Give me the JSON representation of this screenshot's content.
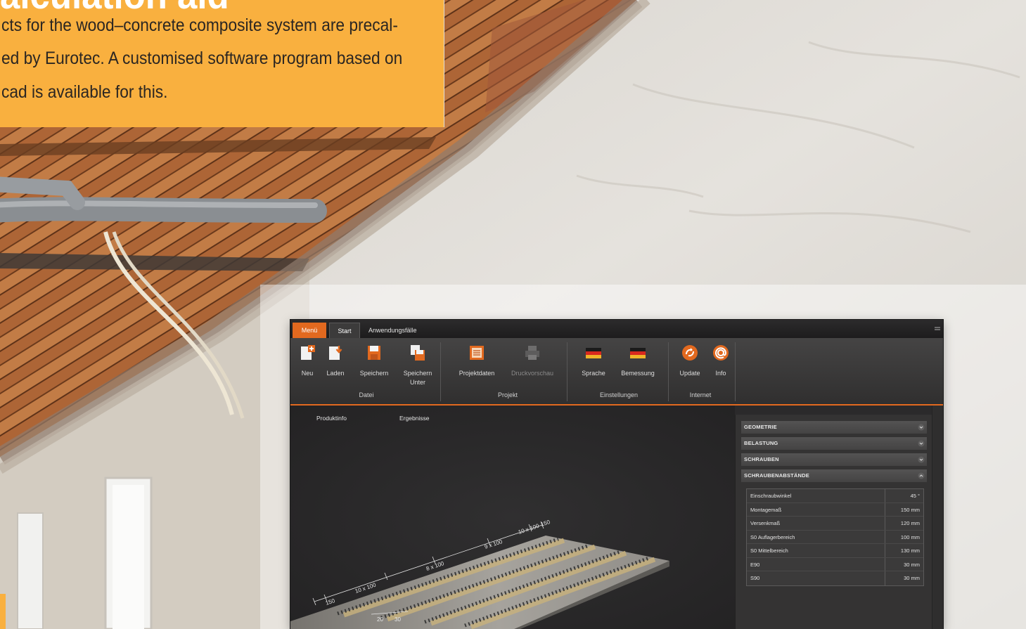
{
  "brochure": {
    "heading": "alculation aid",
    "text_lines": [
      "cts for the wood–concrete composite system are precal-",
      "ed by Eurotec. A customised software program based on",
      "cad is available for this."
    ]
  },
  "app": {
    "tabs": [
      "Menü",
      "Start",
      "Anwendungsfälle"
    ],
    "active_tab": "Start",
    "ribbon": {
      "groups": [
        {
          "label": "Datei",
          "buttons": [
            {
              "label": "Neu",
              "icon": "new-file-icon",
              "enabled": true
            },
            {
              "label": "Laden",
              "icon": "open-file-icon",
              "enabled": true
            },
            {
              "label": "Speichern",
              "icon": "save-icon",
              "enabled": true
            },
            {
              "label": "Speichern Unter",
              "icon": "save-as-icon",
              "enabled": true
            }
          ]
        },
        {
          "label": "Projekt",
          "buttons": [
            {
              "label": "Projektdaten",
              "icon": "project-data-icon",
              "enabled": true
            },
            {
              "label": "Druckvorschau",
              "icon": "print-preview-icon",
              "enabled": false
            }
          ]
        },
        {
          "label": "Einstellungen",
          "buttons": [
            {
              "label": "Sprache",
              "icon": "language-flag-icon",
              "enabled": true
            },
            {
              "label": "Bemessung",
              "icon": "design-standard-flag-icon",
              "enabled": true
            }
          ]
        },
        {
          "label": "Internet",
          "buttons": [
            {
              "label": "Update",
              "icon": "update-icon",
              "enabled": true
            },
            {
              "label": "Info",
              "icon": "info-icon",
              "enabled": true
            }
          ]
        }
      ]
    },
    "content_tabs": [
      "Produktinfo",
      "Ergebnisse"
    ],
    "viewport": {
      "dimension_labels": [
        "150",
        "10 x 100",
        "8 x 100",
        "9 x 100",
        "10 x 100",
        "150",
        "20",
        "30"
      ]
    },
    "properties_panel": {
      "sections": [
        {
          "label": "GEOMETRIE",
          "expanded": false
        },
        {
          "label": "BELASTUNG",
          "expanded": false
        },
        {
          "label": "SCHRAUBEN",
          "expanded": false
        },
        {
          "label": "SCHRAUBENABSTÄNDE",
          "expanded": true
        }
      ],
      "rows": [
        {
          "label": "Einschraubwinkel",
          "value": "45 °"
        },
        {
          "label": "Montagemaß",
          "value": "150 mm"
        },
        {
          "label": "Versenkmaß",
          "value": "120 mm"
        },
        {
          "label": "S0 Auflagerbereich",
          "value": "100 mm"
        },
        {
          "label": "S0 Mittelbereich",
          "value": "130 mm"
        },
        {
          "label": "E90",
          "value": "30 mm"
        },
        {
          "label": "S90",
          "value": "30 mm"
        }
      ]
    }
  },
  "colors": {
    "brochure_accent": "#F9B03F",
    "app_accent": "#E2691F",
    "app_background": "#2B2A2B"
  }
}
